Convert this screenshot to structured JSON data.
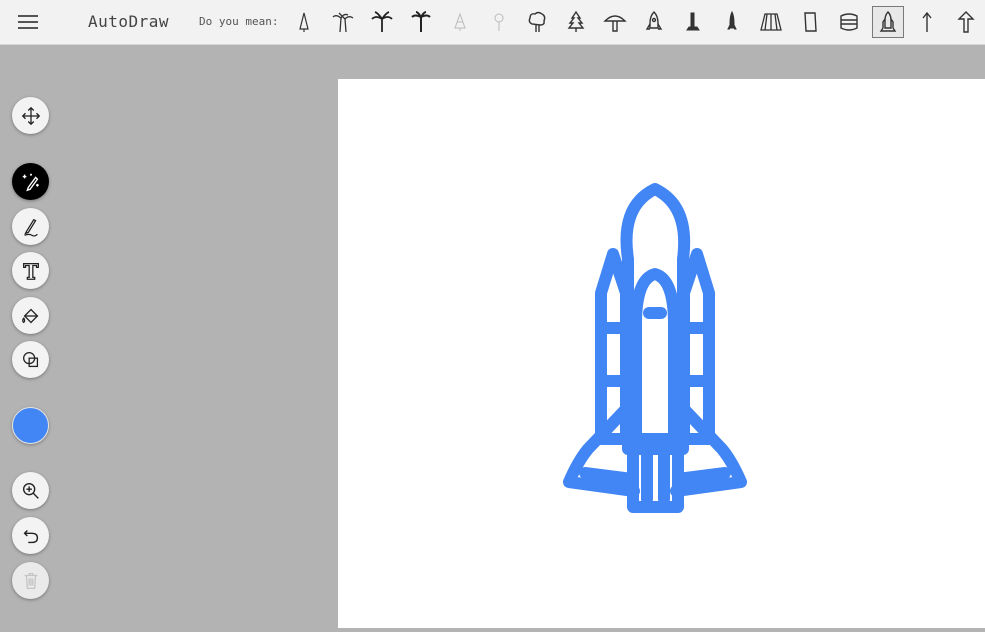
{
  "app": {
    "title": "AutoDraw"
  },
  "suggestions": {
    "label": "Do you mean:",
    "items": [
      {
        "icon": "pine-cone-icon"
      },
      {
        "icon": "palm-trees-icon"
      },
      {
        "icon": "palm-tree-icon"
      },
      {
        "icon": "palm-tree-2-icon"
      },
      {
        "icon": "faint-tree-icon"
      },
      {
        "icon": "faint-lollipop-icon"
      },
      {
        "icon": "round-tree-icon"
      },
      {
        "icon": "pine-tree-icon"
      },
      {
        "icon": "mushroom-icon"
      },
      {
        "icon": "rocket-icon"
      },
      {
        "icon": "launch-tower-icon"
      },
      {
        "icon": "slim-rocket-icon"
      },
      {
        "icon": "skirt-icon"
      },
      {
        "icon": "pants-icon"
      },
      {
        "icon": "stack-icon"
      },
      {
        "icon": "space-shuttle-icon",
        "selected": true
      },
      {
        "icon": "arrow-up-icon"
      },
      {
        "icon": "arrow-up-outline-icon"
      }
    ]
  },
  "toolbar": {
    "tools": [
      {
        "name": "move-tool",
        "icon": "move-icon"
      },
      {
        "name": "autodraw-tool",
        "icon": "autodraw-icon",
        "active": true
      },
      {
        "name": "draw-tool",
        "icon": "pencil-icon"
      },
      {
        "name": "type-tool",
        "icon": "text-icon"
      },
      {
        "name": "fill-tool",
        "icon": "paint-bucket-icon"
      },
      {
        "name": "shape-tool",
        "icon": "shapes-icon"
      },
      {
        "name": "zoom-tool",
        "icon": "zoom-in-icon"
      },
      {
        "name": "undo-button",
        "icon": "undo-icon"
      },
      {
        "name": "delete-button",
        "icon": "trash-icon",
        "disabled": true
      }
    ],
    "current_color": "#4285f4"
  },
  "drawing": {
    "subject": "space-shuttle",
    "stroke_color": "#4285f4"
  }
}
